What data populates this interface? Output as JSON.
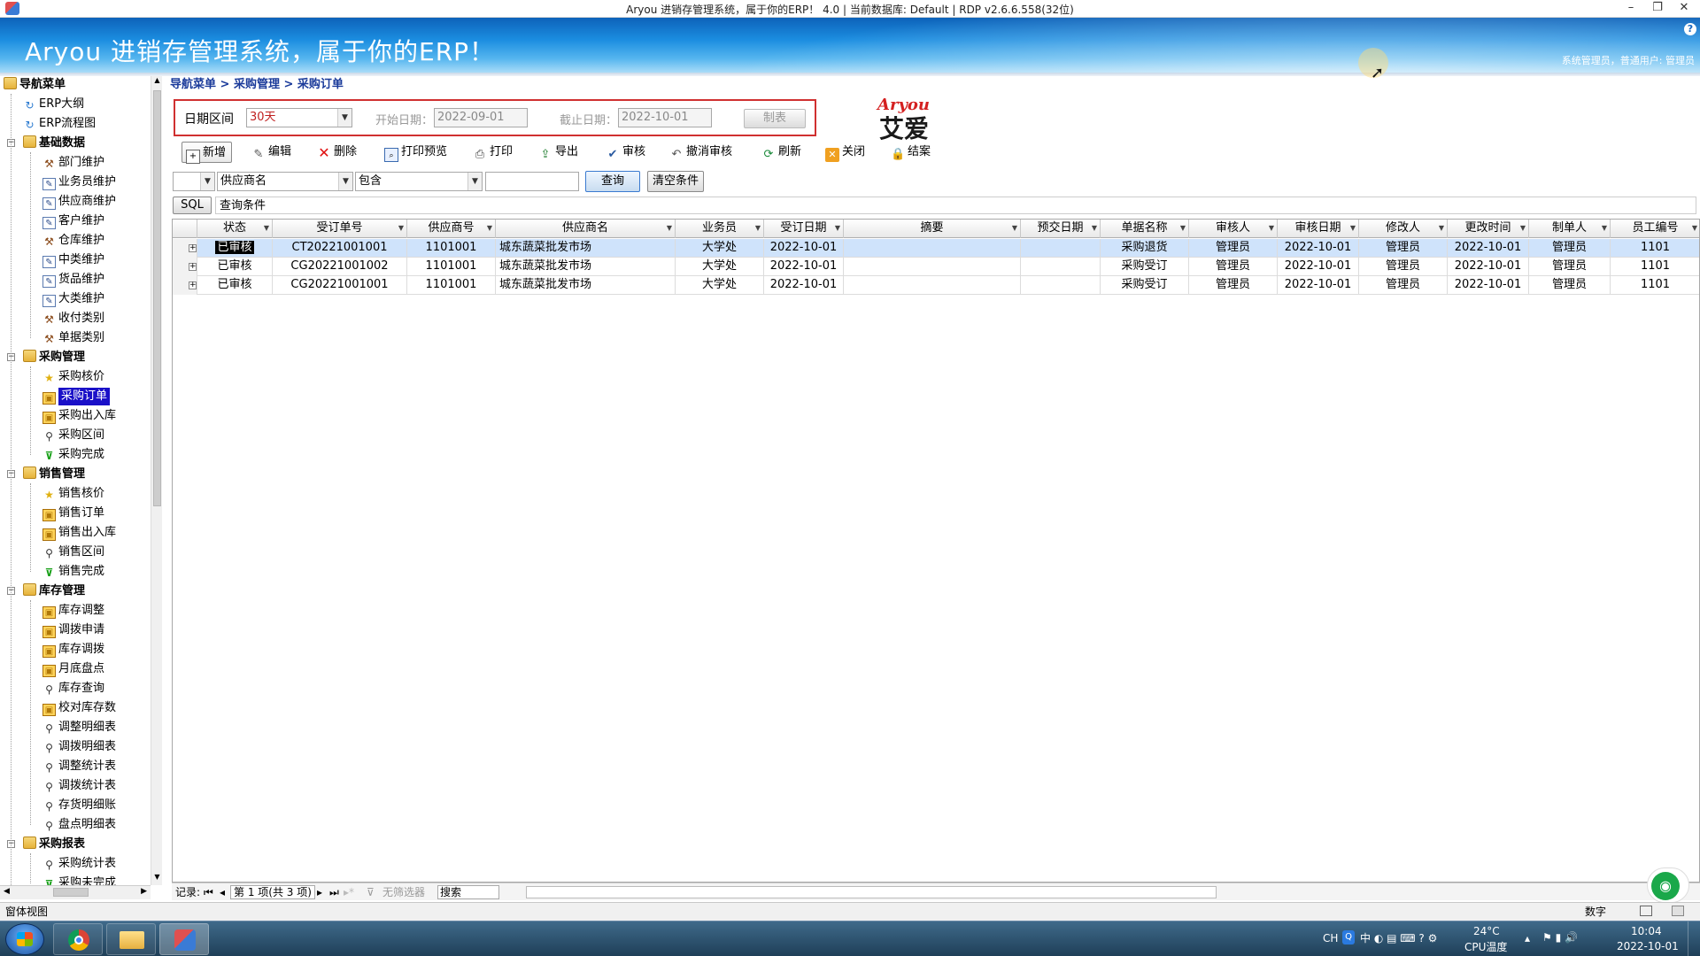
{
  "window": {
    "title": "Aryou 进销存管理系统，属于你的ERP！ 4.0 | 当前数据库: Default | RDP v2.6.6.558(32位)",
    "minimize": "–",
    "restore": "❐",
    "close": "✕"
  },
  "banner": {
    "title": "Aryou 进销存管理系统，属于你的ERP！",
    "user": "系统管理员，普通用户: 管理员",
    "help": "?"
  },
  "nav": {
    "root": "导航菜单",
    "items": [
      {
        "label": "ERP大纲",
        "icon": "cycle-icon"
      },
      {
        "label": "ERP流程图",
        "icon": "cycle-icon"
      },
      {
        "label": "基础数据",
        "icon": "folder-icon",
        "group": true
      },
      {
        "label": "部门维护",
        "icon": "tools-icon"
      },
      {
        "label": "业务员维护",
        "icon": "edit-doc-icon"
      },
      {
        "label": "供应商维护",
        "icon": "edit-doc-icon"
      },
      {
        "label": "客户维护",
        "icon": "edit-doc-icon"
      },
      {
        "label": "仓库维护",
        "icon": "tools-icon"
      },
      {
        "label": "中类维护",
        "icon": "edit-doc-icon"
      },
      {
        "label": "货品维护",
        "icon": "edit-doc-icon"
      },
      {
        "label": "大类维护",
        "icon": "edit-doc-icon"
      },
      {
        "label": "收付类别",
        "icon": "tools-icon"
      },
      {
        "label": "单据类别",
        "icon": "tools-icon"
      },
      {
        "label": "采购管理",
        "icon": "folder-icon",
        "group": true
      },
      {
        "label": "采购核价",
        "icon": "star-icon"
      },
      {
        "label": "采购订单",
        "icon": "box-icon",
        "selected": true
      },
      {
        "label": "采购出入库",
        "icon": "box-icon"
      },
      {
        "label": "采购区间",
        "icon": "search-icon"
      },
      {
        "label": "采购完成",
        "icon": "filter-icon"
      },
      {
        "label": "销售管理",
        "icon": "folder-icon",
        "group": true
      },
      {
        "label": "销售核价",
        "icon": "star-icon"
      },
      {
        "label": "销售订单",
        "icon": "box-icon"
      },
      {
        "label": "销售出入库",
        "icon": "box-icon"
      },
      {
        "label": "销售区间",
        "icon": "search-icon"
      },
      {
        "label": "销售完成",
        "icon": "filter-icon"
      },
      {
        "label": "库存管理",
        "icon": "folder-icon",
        "group": true
      },
      {
        "label": "库存调整",
        "icon": "box-icon"
      },
      {
        "label": "调拨申请",
        "icon": "box-icon"
      },
      {
        "label": "库存调拨",
        "icon": "box-icon"
      },
      {
        "label": "月底盘点",
        "icon": "box-icon"
      },
      {
        "label": "库存查询",
        "icon": "search-icon"
      },
      {
        "label": "校对库存数",
        "icon": "box-icon"
      },
      {
        "label": "调整明细表",
        "icon": "search-icon"
      },
      {
        "label": "调拨明细表",
        "icon": "search-icon"
      },
      {
        "label": "调整统计表",
        "icon": "search-icon"
      },
      {
        "label": "调拨统计表",
        "icon": "search-icon"
      },
      {
        "label": "存货明细账",
        "icon": "search-icon"
      },
      {
        "label": "盘点明细表",
        "icon": "search-icon"
      },
      {
        "label": "采购报表",
        "icon": "folder-icon",
        "group": true
      },
      {
        "label": "采购统计表",
        "icon": "search-icon"
      },
      {
        "label": "采购未完成",
        "icon": "filter-icon"
      }
    ]
  },
  "breadcrumb": "导航菜单 > 采购管理 > 采购订单",
  "daterange": {
    "label": "日期区间",
    "range_value": "30天",
    "start_label": "开始日期：",
    "start_value": "2022-09-01",
    "end_label": "截止日期：",
    "end_value": "2022-10-01",
    "report_button": "制表"
  },
  "logo": {
    "latin": "Aryou",
    "cjk": "艾爱"
  },
  "toolbar": {
    "add": "新增",
    "edit": "编辑",
    "delete": "删除",
    "print_preview": "打印预览",
    "print": "打印",
    "export": "导出",
    "audit": "审核",
    "cancel_audit": "撤消审核",
    "refresh": "刷新",
    "close": "关闭",
    "settle": "结案"
  },
  "filter": {
    "logic_value": "",
    "field_value": "供应商名",
    "operator_value": "包含",
    "keyword_value": "",
    "query_button": "查询",
    "clear_button": "清空条件",
    "sql_button": "SQL",
    "condition_text": "查询条件"
  },
  "grid": {
    "columns": [
      "状态",
      "受订单号",
      "供应商号",
      "供应商名",
      "业务员",
      "受订日期",
      "摘要",
      "预交日期",
      "单据名称",
      "审核人",
      "审核日期",
      "修改人",
      "更改时间",
      "制单人",
      "员工编号"
    ],
    "rows": [
      [
        "已审核",
        "CT20221001001",
        "1101001",
        "城东蔬菜批发市场",
        "大学处",
        "2022-10-01",
        "",
        "",
        "采购退货",
        "管理员",
        "2022-10-01",
        "管理员",
        "2022-10-01",
        "管理员",
        "1101"
      ],
      [
        "已审核",
        "CG20221001002",
        "1101001",
        "城东蔬菜批发市场",
        "大学处",
        "2022-10-01",
        "",
        "",
        "采购受订",
        "管理员",
        "2022-10-01",
        "管理员",
        "2022-10-01",
        "管理员",
        "1101"
      ],
      [
        "已审核",
        "CG20221001001",
        "1101001",
        "城东蔬菜批发市场",
        "大学处",
        "2022-10-01",
        "",
        "",
        "采购受订",
        "管理员",
        "2022-10-01",
        "管理员",
        "2022-10-01",
        "管理员",
        "1101"
      ]
    ],
    "selected_row": 0
  },
  "grid_footer": {
    "record_label": "记录:",
    "page_text": "第 1 项(共 3 项)",
    "no_filter": "无筛选器",
    "search": "搜索"
  },
  "statusbar": {
    "left": "窗体视图",
    "right": "数字"
  },
  "taskbar": {
    "lang": "CH",
    "temp": "24°C",
    "temp_label": "CPU温度",
    "time": "10:04",
    "date": "2022-10-01"
  },
  "colors": {
    "banner_dark": "#0d62b9",
    "selection": "#1a10c8",
    "date_border": "#d03030",
    "row_selected": "#cfe3fb"
  }
}
